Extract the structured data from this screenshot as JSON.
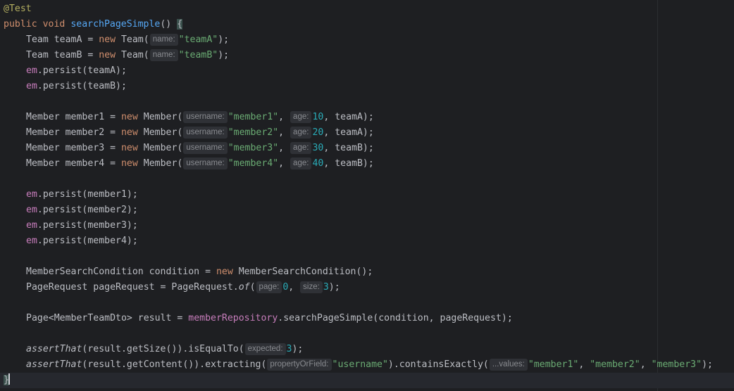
{
  "code": {
    "annotation": "@Test",
    "method_signature": {
      "public": "public",
      "void": "void",
      "name": "searchPageSimple",
      "rest": "() {"
    },
    "teams": [
      {
        "decl": "Team teamA = ",
        "new": "new",
        "ctor": " Team(",
        "hint": "name:",
        "value": "\"teamA\"",
        "end": ");"
      },
      {
        "decl": "Team teamB = ",
        "new": "new",
        "ctor": " Team(",
        "hint": "name:",
        "value": "\"teamB\"",
        "end": ");"
      }
    ],
    "em": "em",
    "team_persists": [
      ".persist(teamA);",
      ".persist(teamB);"
    ],
    "members": [
      {
        "decl": "Member member1 = ",
        "new": "new",
        "ctor": " Member(",
        "hint_username": "username:",
        "username": "\"member1\"",
        "hint_age": "age:",
        "age": "10",
        "team": ", teamA);"
      },
      {
        "decl": "Member member2 = ",
        "new": "new",
        "ctor": " Member(",
        "hint_username": "username:",
        "username": "\"member2\"",
        "hint_age": "age:",
        "age": "20",
        "team": ", teamA);"
      },
      {
        "decl": "Member member3 = ",
        "new": "new",
        "ctor": " Member(",
        "hint_username": "username:",
        "username": "\"member3\"",
        "hint_age": "age:",
        "age": "30",
        "team": ", teamB);"
      },
      {
        "decl": "Member member4 = ",
        "new": "new",
        "ctor": " Member(",
        "hint_username": "username:",
        "username": "\"member4\"",
        "hint_age": "age:",
        "age": "40",
        "team": ", teamB);"
      }
    ],
    "member_persists": [
      ".persist(member1);",
      ".persist(member2);",
      ".persist(member3);",
      ".persist(member4);"
    ],
    "condition": {
      "decl": "MemberSearchCondition condition = ",
      "new": "new",
      "rest": " MemberSearchCondition();"
    },
    "page_request": {
      "decl": "PageRequest pageRequest = PageRequest.",
      "of": "of",
      "open": "(",
      "hint_page": "page:",
      "page": "0",
      "hint_size": "size:",
      "size": "3",
      "end": ");"
    },
    "result": {
      "decl": "Page<MemberTeamDto> result = ",
      "repo": "memberRepository",
      "rest": ".searchPageSimple(condition, pageRequest);"
    },
    "assert1": {
      "fn": "assertThat",
      "mid": "(result.getSize()).isEqualTo(",
      "hint": "expected:",
      "value": "3",
      "end": ");"
    },
    "assert2": {
      "fn": "assertThat",
      "mid": "(result.getContent()).extracting(",
      "hint": "propertyOrField:",
      "prop": "\"username\"",
      "mid2": ").containsExactly(",
      "hint2": "...values:",
      "v1": "\"member1\"",
      "v2": "\"member2\"",
      "v3": "\"member3\"",
      "end": ");"
    },
    "closing": "}"
  }
}
